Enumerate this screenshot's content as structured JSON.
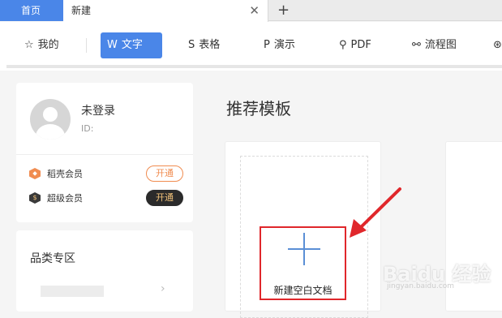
{
  "tabs": {
    "home": "首页",
    "new": "新建",
    "close": "✕",
    "add": "+"
  },
  "toolbar": {
    "items": [
      {
        "icon": "star-icon",
        "glyph": "☆",
        "label": "我的"
      },
      {
        "icon": "w-icon",
        "glyph": "W",
        "label": "文字"
      },
      {
        "icon": "s-icon",
        "glyph": "S",
        "label": "表格"
      },
      {
        "icon": "p-icon",
        "glyph": "P",
        "label": "演示"
      },
      {
        "icon": "pdf-icon",
        "glyph": "⚲",
        "label": "PDF"
      },
      {
        "icon": "flowchart-icon",
        "glyph": "⚯",
        "label": "流程图"
      },
      {
        "icon": "mindmap-icon",
        "glyph": "⊛",
        "label": ""
      }
    ]
  },
  "user": {
    "name": "未登录",
    "id_label": "ID:",
    "memberships": [
      {
        "label": "稻壳会员",
        "button": "开通",
        "color": "#f08c50"
      },
      {
        "label": "超级会员",
        "button": "开通",
        "color": "#3a3a3a"
      }
    ]
  },
  "categories": {
    "title": "品类专区",
    "chevron": "›"
  },
  "main": {
    "title": "推荐模板",
    "new_blank_label": "新建空白文档"
  },
  "watermark": {
    "text": "Baidu 经验",
    "sub": "jingyan.baidu.com"
  },
  "colors": {
    "accent": "#4a86e8",
    "highlight_box": "#e0272b",
    "arrow": "#e0272b"
  }
}
